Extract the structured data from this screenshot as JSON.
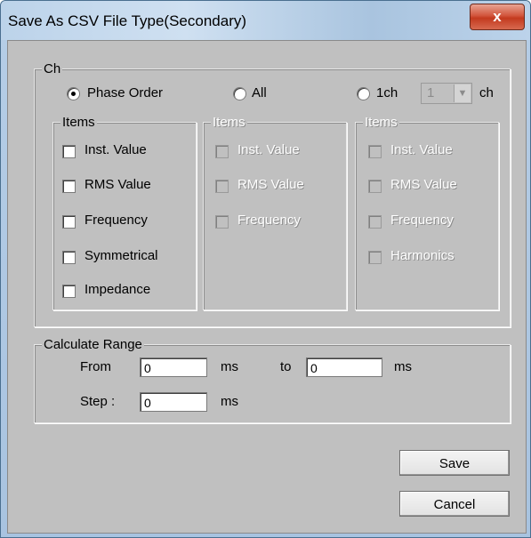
{
  "window": {
    "title": "Save As CSV File Type(Secondary)",
    "close_glyph": "x"
  },
  "ch_group": {
    "label": "Ch",
    "radios": [
      {
        "label": "Phase Order",
        "selected": true
      },
      {
        "label": "All",
        "selected": false
      },
      {
        "label": "1ch",
        "selected": false
      }
    ],
    "channel_select_value": "1",
    "channel_suffix": "ch"
  },
  "items_groups": [
    {
      "label": "Items",
      "enabled": true,
      "items": [
        "Inst. Value",
        "RMS Value",
        "Frequency",
        "Symmetrical",
        "Impedance"
      ]
    },
    {
      "label": "Items",
      "enabled": false,
      "items": [
        "Inst. Value",
        "RMS Value",
        "Frequency"
      ]
    },
    {
      "label": "Items",
      "enabled": false,
      "items": [
        "Inst. Value",
        "RMS Value",
        "Frequency",
        "Harmonics"
      ]
    }
  ],
  "calc_range": {
    "label": "Calculate Range",
    "from_label": "From",
    "from_value": "0",
    "from_unit": "ms",
    "to_label": "to",
    "to_value": "0",
    "to_unit": "ms",
    "step_label": "Step :",
    "step_value": "0",
    "step_unit": "ms"
  },
  "buttons": {
    "save": "Save",
    "cancel": "Cancel"
  },
  "icons": {
    "close": "close-icon",
    "dropdown": "chevron-down-icon"
  }
}
